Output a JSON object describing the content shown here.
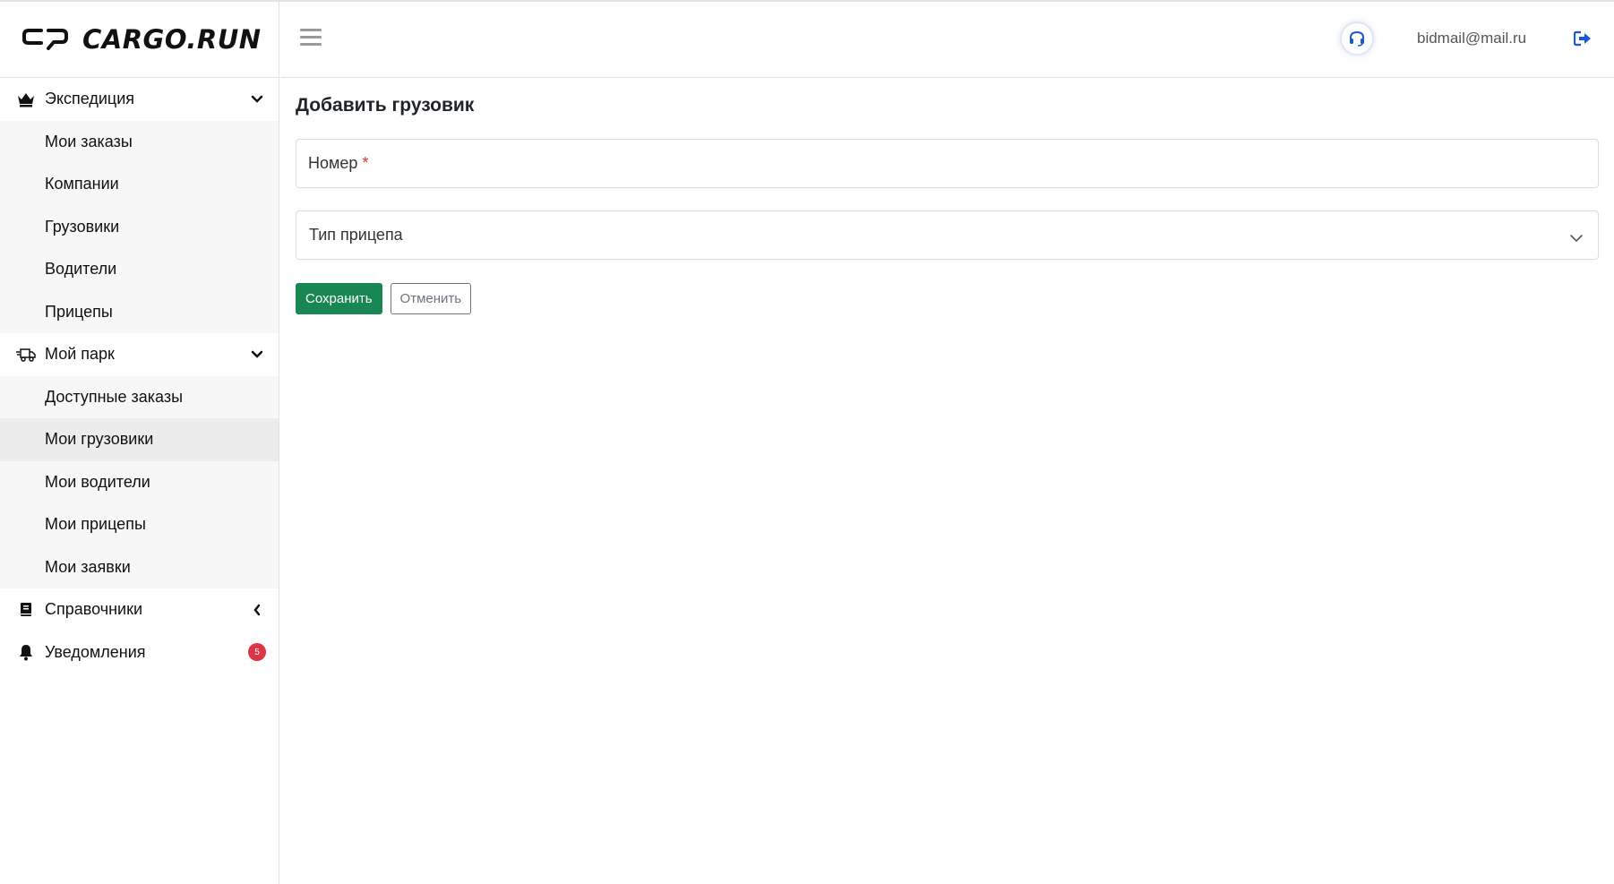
{
  "brand": {
    "name": "CARGO.RUN",
    "logo_icon": "cargo-run-logo"
  },
  "header": {
    "menu_icon": "hamburger-icon",
    "support_icon": "headset-icon",
    "email": "bidmail@mail.ru",
    "logout_icon": "sign-out-icon",
    "accent_color": "#1a56db"
  },
  "sidebar": {
    "groups": [
      {
        "label": "Экспедиция",
        "icon": "crown-icon",
        "chevron": "chevron-down",
        "items": [
          {
            "label": "Мои заказы"
          },
          {
            "label": "Компании"
          },
          {
            "label": "Грузовики"
          },
          {
            "label": "Водители"
          },
          {
            "label": "Прицепы"
          }
        ]
      },
      {
        "label": "Мой парк",
        "icon": "truck-icon",
        "chevron": "chevron-down",
        "items": [
          {
            "label": "Доступные заказы"
          },
          {
            "label": "Мои грузовики",
            "active": true
          },
          {
            "label": "Мои водители"
          },
          {
            "label": "Мои прицепы"
          },
          {
            "label": "Мои заявки"
          }
        ]
      },
      {
        "label": "Справочники",
        "icon": "book-icon",
        "chevron": "chevron-left"
      },
      {
        "label": "Уведомления",
        "icon": "bell-icon",
        "badge": "5",
        "badge_color": "#dc3545"
      }
    ]
  },
  "main": {
    "title": "Добавить грузовик",
    "number_field": {
      "label": "Номер",
      "required_mark": "*"
    },
    "trailer_select": {
      "placeholder": "Тип прицепа"
    },
    "save_label": "Сохранить",
    "cancel_label": "Отменить",
    "save_color": "#198754"
  }
}
